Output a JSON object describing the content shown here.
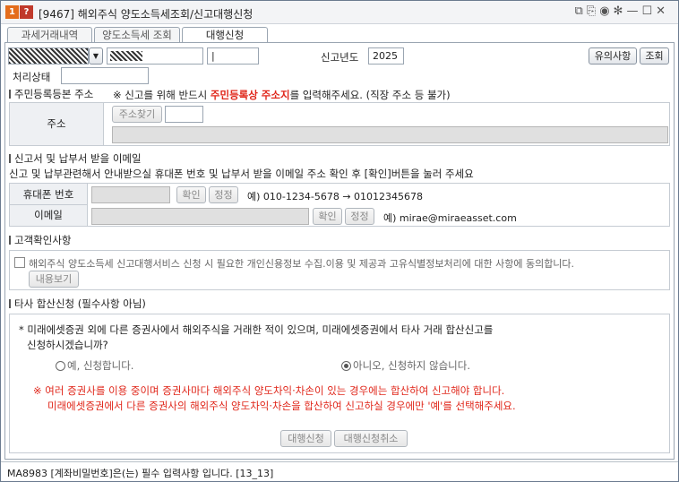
{
  "window": {
    "id_label": "[9467]",
    "title": "해외주식 양도소득세조회/신고대행신청",
    "tool_icons": [
      "layout-icon",
      "copy-icon",
      "camera-icon",
      "gear-icon",
      "minimize-icon",
      "maximize-icon",
      "close-icon"
    ],
    "tool_glyphs": [
      "⧉",
      "⎘",
      "◉",
      "✻",
      "—",
      "☐",
      "✕"
    ]
  },
  "tabs": [
    "과세거래내역",
    "양도소득세 조회",
    "대행신청"
  ],
  "active_tab": 2,
  "top": {
    "account_masked": "▒▒▒▒▒▒▒▒▒▒▒",
    "name_masked": "▒▒▒▒▒",
    "password_value": "|",
    "year_label": "신고년도",
    "year_value": "2025",
    "notice_button": "유의사항",
    "query_button": "조회",
    "status_label": "처리상태",
    "status_value": ""
  },
  "address_section": {
    "title": "주민등록등본 주소",
    "note_prefix": "※ 신고를 위해 반드시 ",
    "note_highlight": "주민등록상 주소지",
    "note_suffix": "를 입력해주세요. (직장 주소 등 불가)",
    "label": "주소",
    "find_button": "주소찾기",
    "zip_value": "",
    "address_value": ""
  },
  "contact_section": {
    "title": "신고서 및 납부서 받을 이메일",
    "desc": "신고 및 납부관련해서 안내받으실 휴대폰 번호 및 납부서 받을 이메일 주소 확인 후 [확인]버튼을 눌러 주세요",
    "phone_label": "휴대폰 번호",
    "phone_value": "",
    "phone_confirm": "확인",
    "phone_edit": "정정",
    "phone_example": "예) 010-1234-5678 → 01012345678",
    "email_label": "이메일",
    "email_value": "",
    "email_confirm": "확인",
    "email_edit": "정정",
    "email_example": "예) mirae@miraeasset.com"
  },
  "consent_section": {
    "title": "고객확인사항",
    "consent_text": "해외주식 양도소득세 신고대행서비스 신청 시 필요한 개인신용정보 수집.이용 및 제공과 고유식별정보처리에 대한 사항에 동의합니다.",
    "view_button": "내용보기",
    "checked": false
  },
  "other_section": {
    "title": "타사 합산신청 (필수사항 아님)",
    "question_line1": "* 미래에셋증권 외에 다른 증권사에서 해외주식을 거래한 적이 있으며, 미래에셋증권에서 타사 거래 합산신고를",
    "question_line2": "신청하시겠습니까?",
    "option_yes": "예, 신청합니다.",
    "option_no": "아니오, 신청하지 않습니다.",
    "selected": "no",
    "warn_line1": "※ 여러 증권사를 이용 중이며 증권사마다 해외주식 양도차익·차손이 있는 경우에는 합산하여 신고해야 합니다.",
    "warn_line2": "미래에셋증권에서 다른 증권사의 해외주식 양도차익·차손을 합산하여 신고하실 경우에만 '예'를 선택해주세요."
  },
  "actions": {
    "apply_button": "대행신청",
    "cancel_button": "대행신청취소"
  },
  "status_message": "MA8983 [계좌비밀번호]은(는) 필수 입력사항 입니다. [13_13]"
}
